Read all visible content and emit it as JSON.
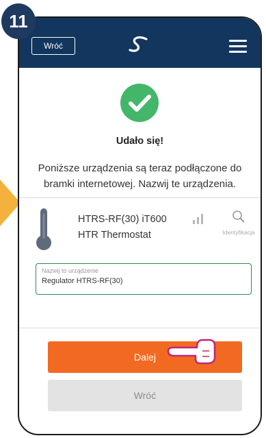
{
  "step_number": "11",
  "header": {
    "back_label": "Wróć",
    "logo_icon": "salus-s-logo",
    "menu_icon": "hamburger-icon"
  },
  "success": {
    "icon": "check-icon",
    "title": "Udało się!",
    "description": "Poniższe urządzenia są teraz podłączone do bramki internetowej. Nazwij te urządzenia."
  },
  "device": {
    "icon": "thermometer-icon",
    "model": "HTRS-RF(30) iT600",
    "type": "HTR Thermostat",
    "signal_icon": "signal-bars-icon",
    "identify_label": "Identyfikacja"
  },
  "name_field": {
    "label": "Nazwij to urządzenie",
    "value": "Regulator HTRS-RF(30)"
  },
  "buttons": {
    "next_label": "Dalej",
    "back_label": "Wróć"
  },
  "colors": {
    "header_bg": "#12365e",
    "primary_orange": "#f26a21",
    "success_green": "#44b669",
    "arrow_yellow": "#f4b23c"
  }
}
